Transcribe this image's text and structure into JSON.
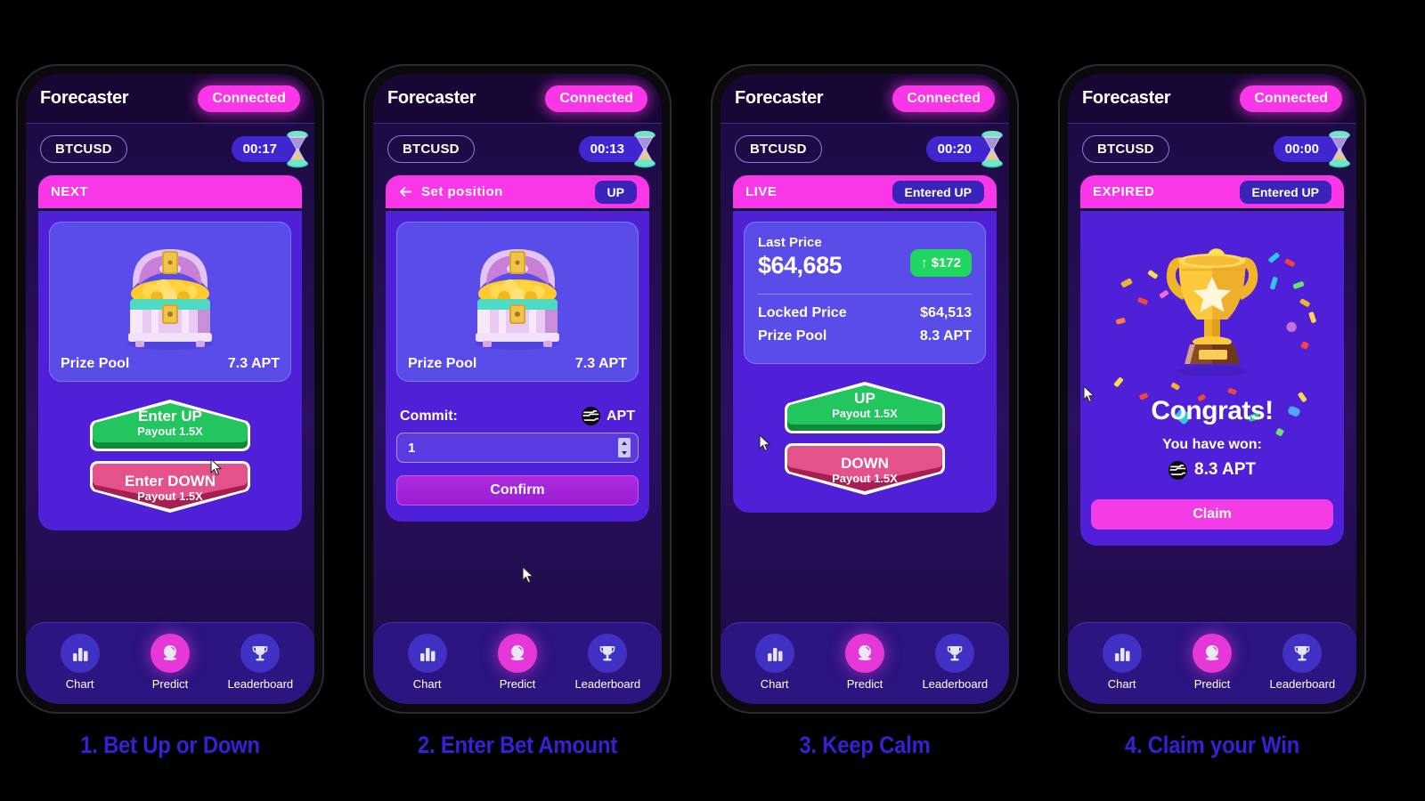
{
  "app": {
    "brand": "Forecaster",
    "wallet_status": "Connected",
    "symbol": "BTCUSD"
  },
  "nav": {
    "items": [
      {
        "label": "Chart",
        "icon": "bar-chart-icon",
        "active": false
      },
      {
        "label": "Predict",
        "icon": "crystal-ball-icon",
        "active": true
      },
      {
        "label": "Leaderboard",
        "icon": "trophy-icon",
        "active": false
      }
    ]
  },
  "colors": {
    "accent_magenta": "#f936e8",
    "card_purple": "#4f20d8",
    "panel_indigo": "#5a4ce8",
    "up_green": "#1fd65f",
    "down_pink": "#e34a84",
    "caption_blue": "#3a1fd6",
    "nav_active": "#e637d8"
  },
  "steps": [
    {
      "caption": "1. Bet Up or Down",
      "timer": "00:17",
      "card_status": "NEXT",
      "prize_pool_label": "Prize Pool",
      "prize_pool_value": "7.3 APT",
      "bet_up": {
        "title": "Enter UP",
        "payout": "Payout 1.5X"
      },
      "bet_down": {
        "title": "Enter DOWN",
        "payout": "Payout 1.5X"
      }
    },
    {
      "caption": "2. Enter Bet Amount",
      "timer": "00:13",
      "card_status": "Set position",
      "position_badge": "UP",
      "prize_pool_label": "Prize Pool",
      "prize_pool_value": "7.3 APT",
      "commit_label": "Commit:",
      "commit_unit": "APT",
      "commit_value": "1",
      "confirm_label": "Confirm"
    },
    {
      "caption": "3. Keep Calm",
      "timer": "00:20",
      "card_status": "LIVE",
      "position_badge": "Entered UP",
      "last_price_label": "Last Price",
      "last_price_value": "$64,685",
      "delta_badge": "↑ $172",
      "locked_price_label": "Locked Price",
      "locked_price_value": "$64,513",
      "prize_pool_label": "Prize Pool",
      "prize_pool_value": "8.3 APT",
      "bet_up": {
        "title": "UP",
        "payout": "Payout 1.5X"
      },
      "bet_down": {
        "title": "DOWN",
        "payout": "Payout 1.5X"
      }
    },
    {
      "caption": "4. Claim your Win",
      "timer": "00:00",
      "card_status": "EXPIRED",
      "position_badge": "Entered UP",
      "congrats_title": "Congrats!",
      "congrats_sub": "You have won:",
      "won_amount": "8.3 APT",
      "claim_label": "Claim"
    }
  ]
}
